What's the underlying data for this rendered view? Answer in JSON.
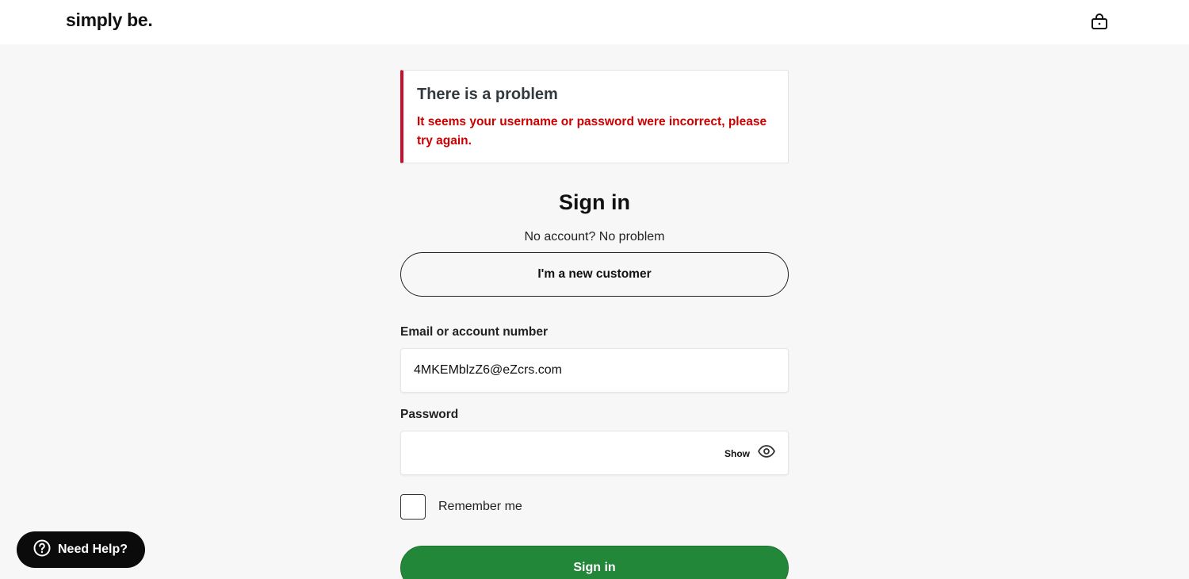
{
  "header": {
    "logo_text": "simply be.",
    "bag_icon": "shopping-bag-icon"
  },
  "alert": {
    "title": "There is a problem",
    "message": "It seems your username or password were incorrect, please try again.",
    "accent_color": "#c8102e",
    "message_color": "#cc0000"
  },
  "signin": {
    "title": "Sign in",
    "no_account_text": "No account? No problem",
    "new_customer_label": "I'm a new customer",
    "email_label": "Email or account number",
    "email_value": "4MKEMblzZ6@eZcrs.com",
    "password_label": "Password",
    "password_value": "",
    "show_label": "Show",
    "show_icon": "eye-icon",
    "remember_label": "Remember me",
    "remember_checked": false,
    "submit_label": "Sign in",
    "submit_color": "#23873a"
  },
  "help": {
    "label": "Need Help?",
    "icon": "question-circle-icon"
  }
}
